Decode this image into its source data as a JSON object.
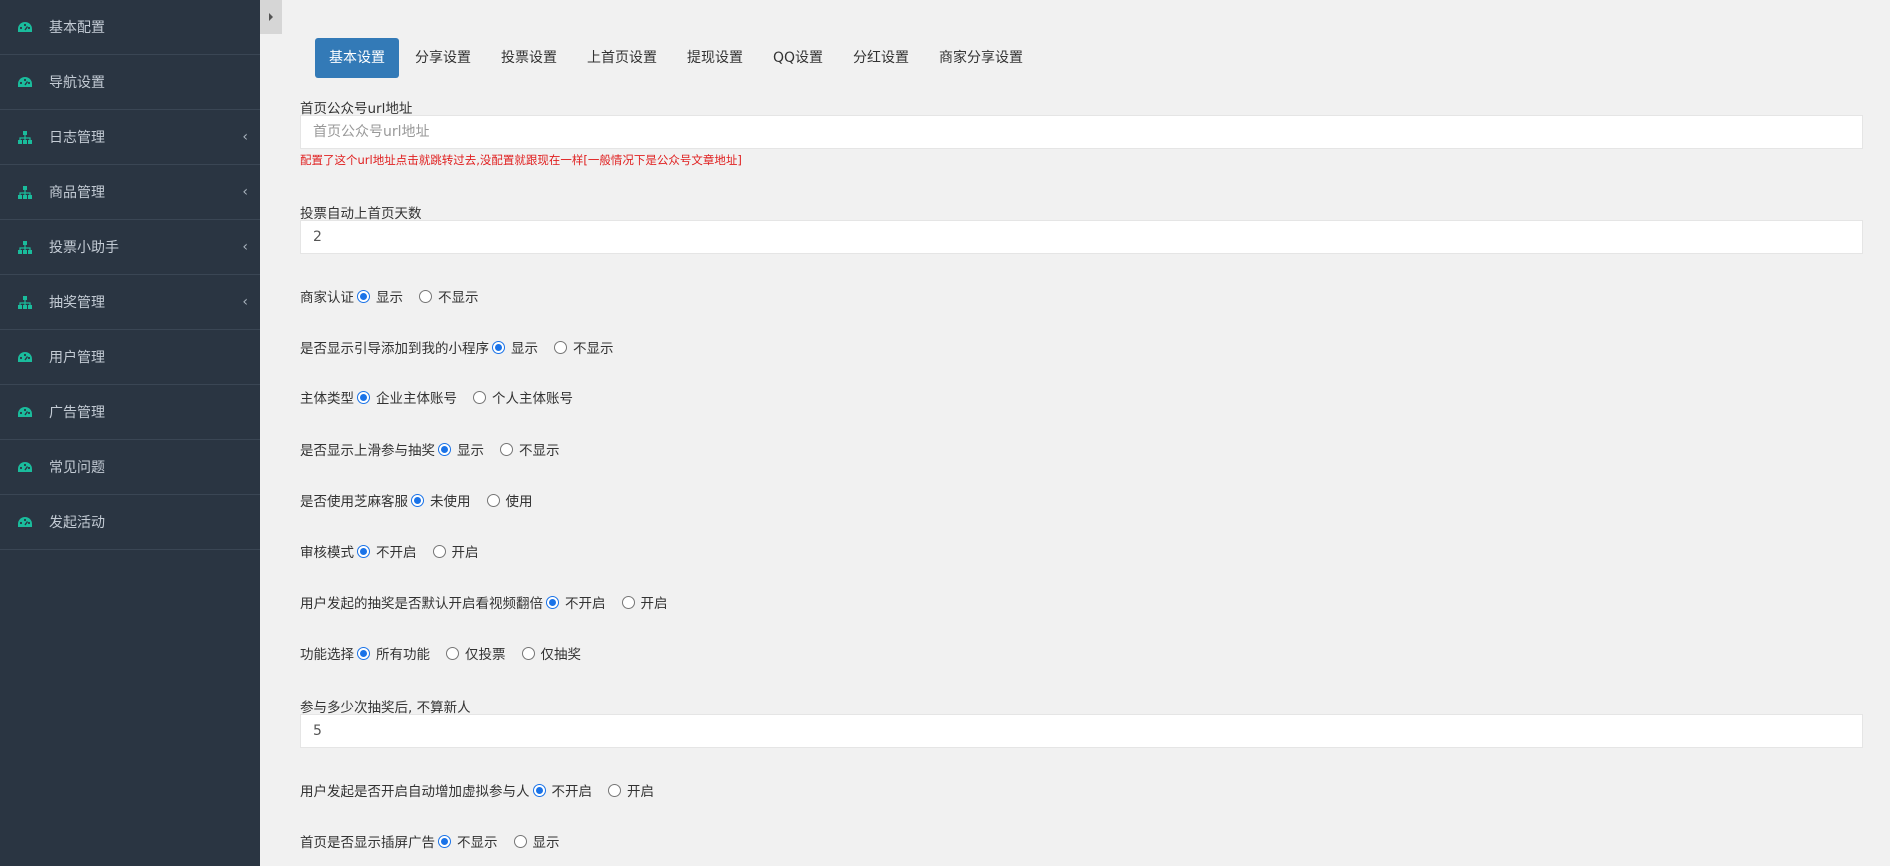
{
  "sidebar": {
    "items": [
      {
        "label": "基本配置",
        "icon": "dashboard-icon",
        "has_children": false
      },
      {
        "label": "导航设置",
        "icon": "dashboard-icon",
        "has_children": false
      },
      {
        "label": "日志管理",
        "icon": "sitemap-icon",
        "has_children": true
      },
      {
        "label": "商品管理",
        "icon": "sitemap-icon",
        "has_children": true
      },
      {
        "label": "投票小助手",
        "icon": "sitemap-icon",
        "has_children": true
      },
      {
        "label": "抽奖管理",
        "icon": "sitemap-icon",
        "has_children": true
      },
      {
        "label": "用户管理",
        "icon": "dashboard-icon",
        "has_children": false
      },
      {
        "label": "广告管理",
        "icon": "dashboard-icon",
        "has_children": false
      },
      {
        "label": "常见问题",
        "icon": "dashboard-icon",
        "has_children": false
      },
      {
        "label": "发起活动",
        "icon": "dashboard-icon",
        "has_children": false
      }
    ],
    "chevron": "‹"
  },
  "tabs": [
    {
      "label": "基本设置",
      "active": true
    },
    {
      "label": "分享设置",
      "active": false
    },
    {
      "label": "投票设置",
      "active": false
    },
    {
      "label": "上首页设置",
      "active": false
    },
    {
      "label": "提现设置",
      "active": false
    },
    {
      "label": "QQ设置",
      "active": false
    },
    {
      "label": "分红设置",
      "active": false
    },
    {
      "label": "商家分享设置",
      "active": false
    }
  ],
  "form": {
    "url_field": {
      "label": "首页公众号url地址",
      "value": "",
      "placeholder": "首页公众号url地址",
      "hint": "配置了这个url地址点击就跳转过去,没配置就跟现在一样[一般情况下是公众号文章地址]"
    },
    "vote_days": {
      "label": "投票自动上首页天数",
      "value": "2"
    },
    "merchant_auth": {
      "label": "商家认证",
      "options": [
        "显示",
        "不显示"
      ],
      "selected": 0
    },
    "guide_add": {
      "label": "是否显示引导添加到我的小程序",
      "options": [
        "显示",
        "不显示"
      ],
      "selected": 0
    },
    "subject_type": {
      "label": "主体类型",
      "options": [
        "企业主体账号",
        "个人主体账号"
      ],
      "selected": 0
    },
    "slide_lottery": {
      "label": "是否显示上滑参与抽奖",
      "options": [
        "显示",
        "不显示"
      ],
      "selected": 0
    },
    "sesame_service": {
      "label": "是否使用芝麻客服",
      "options": [
        "未使用",
        "使用"
      ],
      "selected": 0
    },
    "review_mode": {
      "label": "审核模式",
      "options": [
        "不开启",
        "开启"
      ],
      "selected": 0
    },
    "video_double": {
      "label": "用户发起的抽奖是否默认开启看视频翻倍",
      "options": [
        "不开启",
        "开启"
      ],
      "selected": 0
    },
    "feature_select": {
      "label": "功能选择",
      "options": [
        "所有功能",
        "仅投票",
        "仅抽奖"
      ],
      "selected": 0
    },
    "lottery_times": {
      "label": "参与多少次抽奖后, 不算新人",
      "value": "5"
    },
    "virtual_participants": {
      "label": "用户发起是否开启自动增加虚拟参与人",
      "options": [
        "不开启",
        "开启"
      ],
      "selected": 0
    },
    "interstitial_ad": {
      "label": "首页是否显示插屏广告",
      "options": [
        "不显示",
        "显示"
      ],
      "selected": 0
    }
  }
}
